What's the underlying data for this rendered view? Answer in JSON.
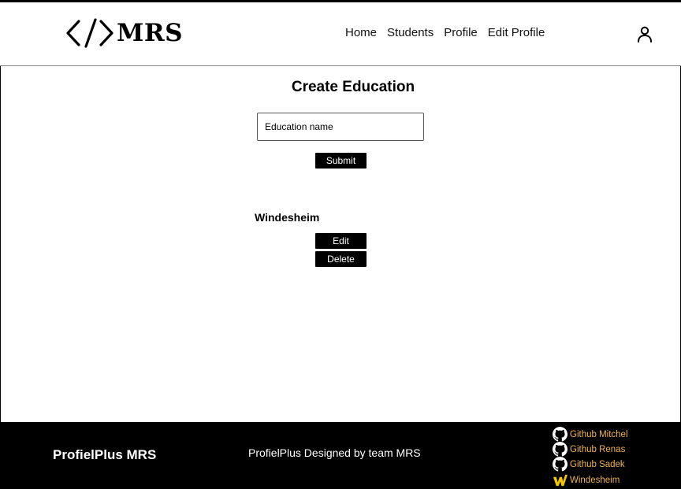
{
  "header": {
    "logo_text": "MRS",
    "nav": [
      {
        "label": "Home"
      },
      {
        "label": "Students"
      },
      {
        "label": "Profile"
      },
      {
        "label": "Edit Profile"
      }
    ],
    "user_icon": "user-icon"
  },
  "main": {
    "title": "Create Education",
    "input": {
      "placeholder": "Education name",
      "value": ""
    },
    "submit_label": "Submit",
    "educations": [
      {
        "name": "Windesheim",
        "edit_label": "Edit",
        "delete_label": "Delete"
      }
    ]
  },
  "footer": {
    "brand": "ProfielPlus MRS",
    "credit": "ProfielPlus Designed by team MRS",
    "links": [
      {
        "label": "Github Mitchel",
        "icon": "github-icon"
      },
      {
        "label": "Github Renas",
        "icon": "github-icon"
      },
      {
        "label": "Github Sadek",
        "icon": "github-icon"
      },
      {
        "label": "Windesheim",
        "icon": "windesheim-icon"
      }
    ],
    "link_color": "#f0b24a"
  }
}
